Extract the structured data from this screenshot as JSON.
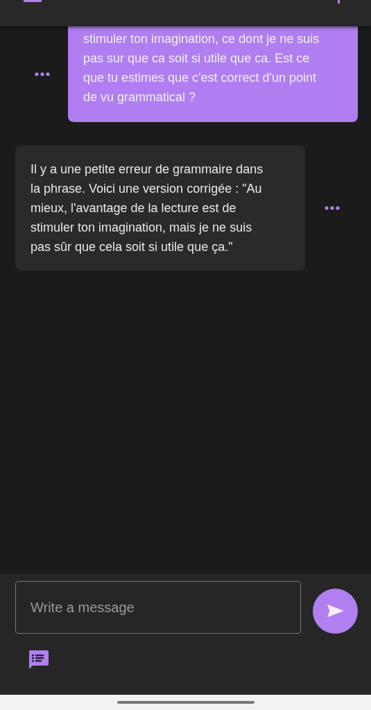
{
  "messages": [
    {
      "kind": "sent",
      "text": "stimuler ton imagination, ce dont je ne suis pas sur que ca soit si utile que ca. Est ce que tu estimes que c'est correct d'un point de vu grammatical ?"
    },
    {
      "kind": "received",
      "text": "Il y a une petite erreur de grammaire dans la phrase. Voici une version corrigée : \"Au mieux, l'avantage de la lecture est de stimuler ton imagination, mais je ne suis pas sûr que cela soit si utile que ça.\""
    }
  ],
  "composer": {
    "placeholder": "Write a message"
  }
}
